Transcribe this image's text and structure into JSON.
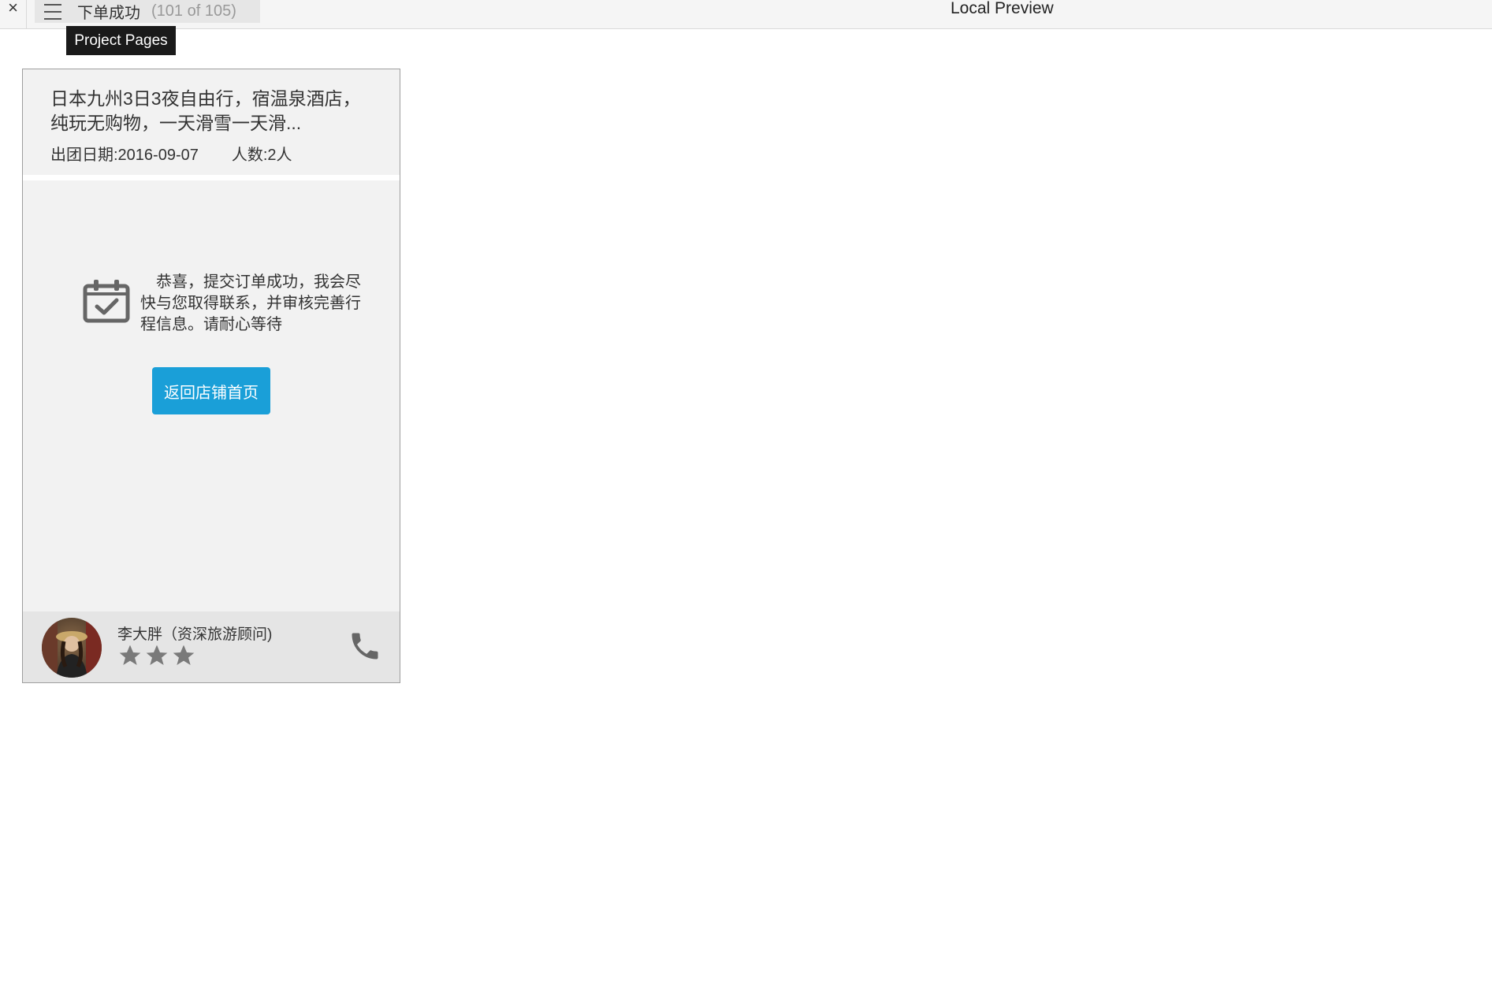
{
  "topbar": {
    "close_glyph": "×",
    "page_name": "下单成功",
    "page_count": "(101 of 105)",
    "app_title": "Local Preview"
  },
  "tooltip": {
    "text": "Project Pages"
  },
  "order": {
    "title": "日本九州3日3夜自由行，宿温泉酒店，纯玩无购物，一天滑雪一天滑...",
    "date": "出团日期:2016-09-07",
    "people": "人数:2人"
  },
  "success": {
    "message": "恭喜，提交订单成功，我会尽快与您取得联系，并审核完善行程信息。请耐心等待",
    "home_button_label": "返回店铺首页"
  },
  "advisor": {
    "name": "李大胖（资深旅游顾问)",
    "rating": 3
  },
  "colors": {
    "accent": "#1a9fd8",
    "icon_gray": "#666666"
  }
}
